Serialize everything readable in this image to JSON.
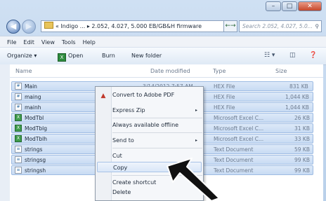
{
  "window": {
    "caption_buttons": [
      "–",
      "□",
      "✕"
    ]
  },
  "address": {
    "path": "« Indigo ... ▸ 2.052, 4.027, 5.000 EB/GB&H firmware",
    "dropdown": "▾",
    "refresh": "←→",
    "search_placeholder": "Search 2.052, 4.027, 5.0...",
    "search_icon": "search-icon"
  },
  "menubar": [
    "File",
    "Edit",
    "View",
    "Tools",
    "Help"
  ],
  "toolbar": {
    "organize": "Organize ▾",
    "open": "Open",
    "burn": "Burn",
    "new_folder": "New folder"
  },
  "columns": {
    "name": "Name",
    "date": "Date modified",
    "type": "Type",
    "size": "Size"
  },
  "files": [
    {
      "name": "Main",
      "date": "3/14/2012 7:57 AM",
      "type": "HEX File",
      "size": "831 KB"
    },
    {
      "name": "maing",
      "date": "",
      "type": "HEX File",
      "size": "1,044 KB"
    },
    {
      "name": "mainh",
      "date": "",
      "type": "HEX File",
      "size": "1,044 KB"
    },
    {
      "name": "ModTbl",
      "date": "",
      "type": "Microsoft Excel C...",
      "size": "26 KB"
    },
    {
      "name": "ModTblg",
      "date": "",
      "type": "Microsoft Excel C...",
      "size": "31 KB"
    },
    {
      "name": "ModTblh",
      "date": "",
      "type": "Microsoft Excel C...",
      "size": "33 KB"
    },
    {
      "name": "strings",
      "date": "",
      "type": "Text Document",
      "size": "59 KB"
    },
    {
      "name": "stringsg",
      "date": "",
      "type": "Text Document",
      "size": "99 KB"
    },
    {
      "name": "stringsh",
      "date": "",
      "type": "Text Document",
      "size": "99 KB"
    }
  ],
  "context_menu": {
    "items": [
      {
        "label": "Convert to Adobe PDF",
        "submenu": false
      },
      {
        "label": "Express Zip",
        "submenu": true
      },
      {
        "label": "Always available offline",
        "submenu": false
      },
      {
        "label": "Send to",
        "submenu": true
      },
      {
        "label": "Cut",
        "submenu": false
      },
      {
        "label": "Copy",
        "submenu": false
      },
      {
        "label": "Create shortcut",
        "submenu": false
      },
      {
        "label": "Delete",
        "submenu": false
      }
    ],
    "submenu_glyph": "▸"
  },
  "colors": {
    "selection": "#c8dbf3",
    "accent": "#2e6da4"
  }
}
